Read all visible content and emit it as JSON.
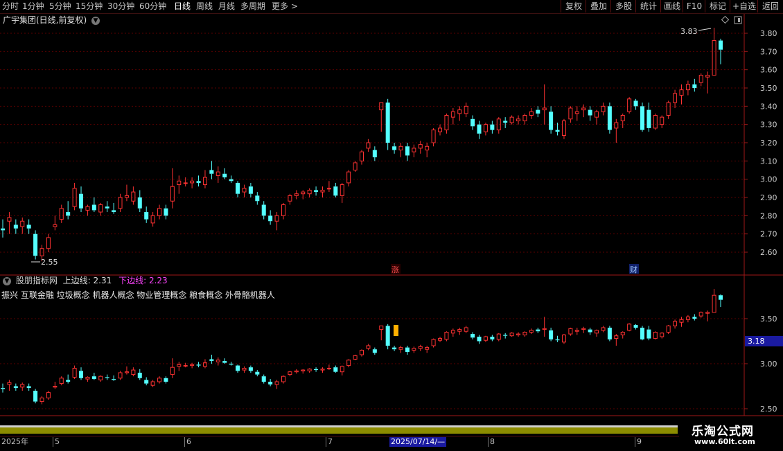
{
  "toolbar": {
    "timeframes": [
      "分时",
      "1分钟",
      "5分钟",
      "15分钟",
      "30分钟",
      "60分钟",
      "日线",
      "周线",
      "月线",
      "多周期",
      "更多 >"
    ],
    "active_timeframe": "日线",
    "right_buttons": [
      "复权",
      "叠加",
      "多股",
      "统计",
      "画线",
      "F10",
      "标记",
      "+自选",
      "返回"
    ]
  },
  "main_chart": {
    "title": "广宇集团(日线,前复权)",
    "high_label": "3.83",
    "low_label": "2.55",
    "markers": [
      "涨",
      "财"
    ],
    "y_ticks": [
      "3.80",
      "3.70",
      "3.60",
      "3.50",
      "3.40",
      "3.30",
      "3.20",
      "3.10",
      "3.00",
      "2.90",
      "2.80",
      "2.70",
      "2.60"
    ]
  },
  "indicator": {
    "name": "股朋指标网",
    "upper_label": "上边线:",
    "upper_value": "2.31",
    "lower_label": "下边线:",
    "lower_value": "2.23",
    "concepts": "振兴 互联金融 垃圾概念 机器人概念 物业管理概念 粮食概念 外骨骼机器人",
    "current_value": "3.18",
    "y_ticks": [
      "3.50",
      "3.00",
      "2.50"
    ]
  },
  "date_axis": {
    "labels": [
      "2025年",
      "5",
      "6",
      "7",
      "2025/07/14/—",
      "8",
      "9"
    ]
  },
  "watermark": {
    "line1": "乐淘公式网",
    "line2": "www.60lt.com"
  },
  "colors": {
    "up": "#ff3232",
    "down": "#54ffff",
    "grid": "#5a0000",
    "axis_border": "#a01818",
    "accent_blue": "#1a1aa0",
    "purple": "#ff44ff",
    "olive": "#8c8c00"
  },
  "chart_data": {
    "type": "candlestick",
    "title": "广宇集团(日线,前复权)",
    "ylim": [
      2.53,
      3.85
    ],
    "candles": [
      [
        2.73,
        2.78,
        2.68,
        2.72
      ],
      [
        2.77,
        2.82,
        2.7,
        2.79
      ],
      [
        2.75,
        2.78,
        2.7,
        2.73
      ],
      [
        2.74,
        2.79,
        2.7,
        2.77
      ],
      [
        2.75,
        2.78,
        2.7,
        2.73
      ],
      [
        2.7,
        2.72,
        2.56,
        2.58
      ],
      [
        2.58,
        2.64,
        2.55,
        2.62
      ],
      [
        2.62,
        2.7,
        2.6,
        2.68
      ],
      [
        2.74,
        2.8,
        2.72,
        2.75
      ],
      [
        2.78,
        2.86,
        2.76,
        2.84
      ],
      [
        2.82,
        2.88,
        2.78,
        2.8
      ],
      [
        2.85,
        2.98,
        2.83,
        2.95
      ],
      [
        2.92,
        2.96,
        2.82,
        2.84
      ],
      [
        2.83,
        2.86,
        2.8,
        2.85
      ],
      [
        2.86,
        2.9,
        2.82,
        2.83
      ],
      [
        2.82,
        2.87,
        2.8,
        2.86
      ],
      [
        2.85,
        2.88,
        2.82,
        2.84
      ],
      [
        2.83,
        2.87,
        2.81,
        2.82
      ],
      [
        2.84,
        2.92,
        2.82,
        2.9
      ],
      [
        2.9,
        2.97,
        2.88,
        2.91
      ],
      [
        2.88,
        2.96,
        2.86,
        2.93
      ],
      [
        2.9,
        2.94,
        2.82,
        2.84
      ],
      [
        2.82,
        2.85,
        2.76,
        2.78
      ],
      [
        2.76,
        2.82,
        2.74,
        2.8
      ],
      [
        2.8,
        2.86,
        2.78,
        2.84
      ],
      [
        2.84,
        2.86,
        2.78,
        2.8
      ],
      [
        2.88,
        3.06,
        2.84,
        2.96
      ],
      [
        2.97,
        3.02,
        2.92,
        2.99
      ],
      [
        2.98,
        3.01,
        2.96,
        2.98
      ],
      [
        2.98,
        3.01,
        2.95,
        2.99
      ],
      [
        2.99,
        3.02,
        2.96,
        2.98
      ],
      [
        2.97,
        3.05,
        2.95,
        3.01
      ],
      [
        3.05,
        3.1,
        3.0,
        3.03
      ],
      [
        3.02,
        3.07,
        2.98,
        3.04
      ],
      [
        3.03,
        3.06,
        3.0,
        3.01
      ],
      [
        3.0,
        3.02,
        2.98,
        2.99
      ],
      [
        2.98,
        2.99,
        2.9,
        2.92
      ],
      [
        2.93,
        2.97,
        2.9,
        2.95
      ],
      [
        2.96,
        2.98,
        2.9,
        2.92
      ],
      [
        2.91,
        2.93,
        2.86,
        2.88
      ],
      [
        2.86,
        2.88,
        2.78,
        2.8
      ],
      [
        2.8,
        2.83,
        2.75,
        2.77
      ],
      [
        2.77,
        2.82,
        2.72,
        2.8
      ],
      [
        2.8,
        2.87,
        2.78,
        2.86
      ],
      [
        2.88,
        2.92,
        2.86,
        2.91
      ],
      [
        2.91,
        2.94,
        2.89,
        2.92
      ],
      [
        2.92,
        2.94,
        2.89,
        2.93
      ],
      [
        2.92,
        2.95,
        2.9,
        2.94
      ],
      [
        2.94,
        2.96,
        2.91,
        2.93
      ],
      [
        2.93,
        2.96,
        2.9,
        2.94
      ],
      [
        2.95,
        2.99,
        2.93,
        2.95
      ],
      [
        2.96,
        2.98,
        2.9,
        2.91
      ],
      [
        2.91,
        2.98,
        2.87,
        2.97
      ],
      [
        2.98,
        3.05,
        2.96,
        3.04
      ],
      [
        3.05,
        3.1,
        3.04,
        3.09
      ],
      [
        3.1,
        3.16,
        3.08,
        3.15
      ],
      [
        3.17,
        3.22,
        3.15,
        3.2
      ],
      [
        3.16,
        3.18,
        3.1,
        3.12
      ],
      [
        3.38,
        3.42,
        3.26,
        3.42
      ],
      [
        3.42,
        3.44,
        3.16,
        3.2
      ],
      [
        3.18,
        3.2,
        3.14,
        3.16
      ],
      [
        3.16,
        3.2,
        3.12,
        3.18
      ],
      [
        3.18,
        3.2,
        3.1,
        3.13
      ],
      [
        3.15,
        3.19,
        3.12,
        3.17
      ],
      [
        3.17,
        3.21,
        3.14,
        3.19
      ],
      [
        3.16,
        3.2,
        3.12,
        3.18
      ],
      [
        3.2,
        3.28,
        3.18,
        3.27
      ],
      [
        3.26,
        3.3,
        3.24,
        3.28
      ],
      [
        3.27,
        3.36,
        3.25,
        3.35
      ],
      [
        3.34,
        3.39,
        3.3,
        3.37
      ],
      [
        3.36,
        3.4,
        3.32,
        3.38
      ],
      [
        3.36,
        3.42,
        3.34,
        3.4
      ],
      [
        3.33,
        3.35,
        3.27,
        3.29
      ],
      [
        3.3,
        3.32,
        3.22,
        3.25
      ],
      [
        3.26,
        3.31,
        3.24,
        3.3
      ],
      [
        3.3,
        3.32,
        3.25,
        3.27
      ],
      [
        3.27,
        3.34,
        3.25,
        3.33
      ],
      [
        3.32,
        3.34,
        3.28,
        3.31
      ],
      [
        3.31,
        3.35,
        3.3,
        3.34
      ],
      [
        3.32,
        3.35,
        3.3,
        3.33
      ],
      [
        3.32,
        3.36,
        3.3,
        3.35
      ],
      [
        3.35,
        3.39,
        3.33,
        3.37
      ],
      [
        3.38,
        3.4,
        3.34,
        3.36
      ],
      [
        3.38,
        3.52,
        3.3,
        3.39
      ],
      [
        3.37,
        3.4,
        3.25,
        3.27
      ],
      [
        3.27,
        3.31,
        3.24,
        3.26
      ],
      [
        3.24,
        3.33,
        3.22,
        3.32
      ],
      [
        3.33,
        3.4,
        3.31,
        3.39
      ],
      [
        3.36,
        3.4,
        3.32,
        3.37
      ],
      [
        3.38,
        3.41,
        3.34,
        3.39
      ],
      [
        3.38,
        3.4,
        3.32,
        3.35
      ],
      [
        3.34,
        3.38,
        3.3,
        3.37
      ],
      [
        3.37,
        3.42,
        3.35,
        3.4
      ],
      [
        3.4,
        3.42,
        3.25,
        3.27
      ],
      [
        3.28,
        3.33,
        3.2,
        3.31
      ],
      [
        3.32,
        3.36,
        3.28,
        3.35
      ],
      [
        3.37,
        3.45,
        3.36,
        3.44
      ],
      [
        3.43,
        3.44,
        3.38,
        3.4
      ],
      [
        3.4,
        3.42,
        3.26,
        3.27
      ],
      [
        3.38,
        3.42,
        3.26,
        3.28
      ],
      [
        3.28,
        3.36,
        3.27,
        3.35
      ],
      [
        3.3,
        3.35,
        3.28,
        3.34
      ],
      [
        3.35,
        3.43,
        3.33,
        3.42
      ],
      [
        3.42,
        3.49,
        3.39,
        3.47
      ],
      [
        3.46,
        3.52,
        3.41,
        3.49
      ],
      [
        3.49,
        3.54,
        3.46,
        3.52
      ],
      [
        3.52,
        3.55,
        3.48,
        3.5
      ],
      [
        3.53,
        3.58,
        3.51,
        3.57
      ],
      [
        3.56,
        3.59,
        3.47,
        3.57
      ],
      [
        3.57,
        3.83,
        3.57,
        3.76
      ],
      [
        3.76,
        3.77,
        3.63,
        3.71
      ]
    ],
    "upper_line": 2.31,
    "lower_line": 2.23
  }
}
